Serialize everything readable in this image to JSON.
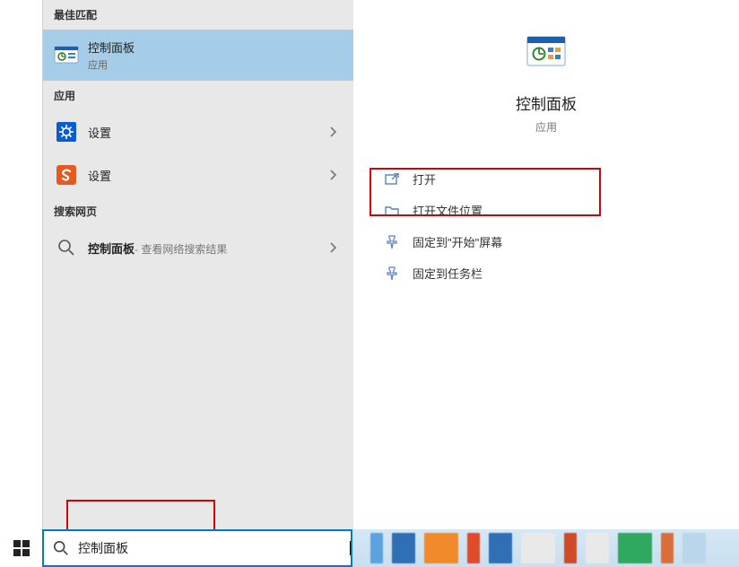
{
  "sections": {
    "best_match": "最佳匹配",
    "apps": "应用",
    "web": "搜索网页"
  },
  "results": {
    "selected": {
      "title": "控制面板",
      "sub": "应用"
    },
    "app1": {
      "title": "设置"
    },
    "app2": {
      "title": "设置"
    },
    "web1": {
      "title": "控制面板",
      "suffix": " - 查看网络搜索结果"
    }
  },
  "preview": {
    "title": "控制面板",
    "sub": "应用",
    "actions": {
      "open": "打开",
      "open_location": "打开文件位置",
      "pin_start": "固定到\"开始\"屏幕",
      "pin_taskbar": "固定到任务栏"
    }
  },
  "search": {
    "value": "控制面板"
  },
  "taskbar_colors": [
    "#5aa3e0",
    "#2f6fb5",
    "#f08a2a",
    "#e04b2a",
    "#2f6fb5",
    "#e9e9e9",
    "#d04a2a",
    "#e9e9e9",
    "#2fa860",
    "#d86f3a",
    "#b9d6ea"
  ]
}
